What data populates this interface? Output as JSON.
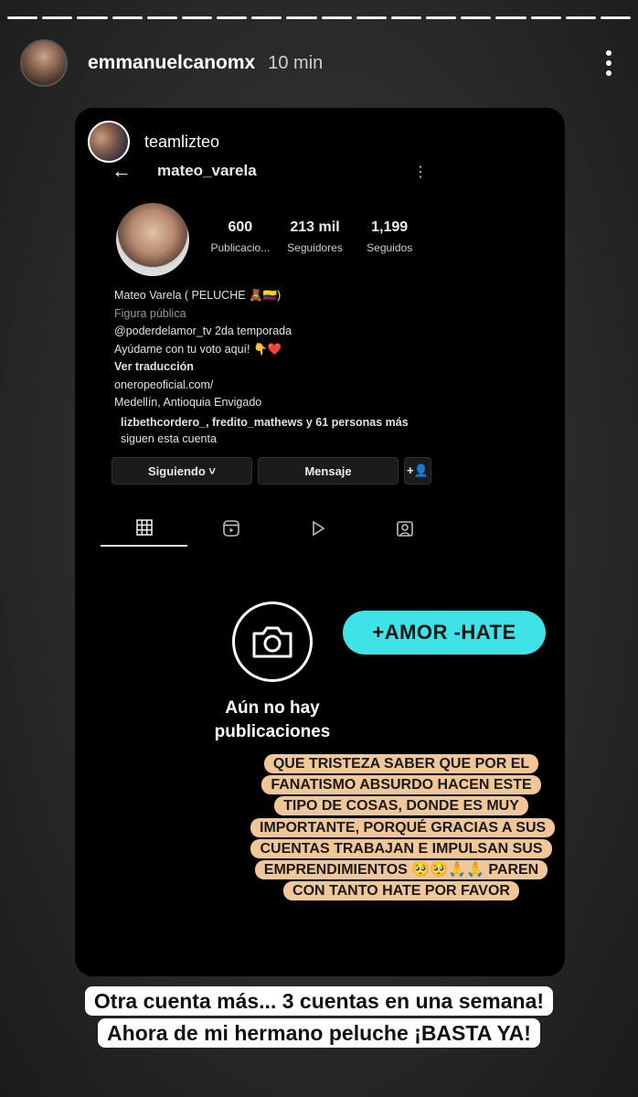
{
  "story": {
    "username": "emmanuelcanomx",
    "time": "10 min",
    "progress_segments": 18
  },
  "embedded": {
    "team_account": "teamlizteo",
    "profile": {
      "username": "mateo_varela",
      "stats": [
        {
          "value": "600",
          "label": "Publicacio..."
        },
        {
          "value": "213 mil",
          "label": "Seguidores"
        },
        {
          "value": "1,199",
          "label": "Seguidos"
        }
      ],
      "bio": {
        "name": "Mateo Varela ( PELUCHE 🧸🇨🇴)",
        "category": "Figura pública",
        "line1": "@poderdelamor_tv  2da temporada",
        "line2": "Ayúdame con tu voto aquí! 👇❤️",
        "translate": "Ver traducción",
        "link": "oneropeoficial.com/",
        "location": "Medellín, Antioquia Envigado"
      },
      "followed_by": {
        "line1": "lizbethcordero_, fredito_mathews y 61 personas más",
        "line2": "siguen esta cuenta"
      },
      "buttons": {
        "following": "Siguiendo ˅",
        "message": "Mensaje",
        "add_user": "+👤"
      },
      "empty_state": "Aún no hay publicaciones"
    }
  },
  "stickers": {
    "amor": "+AMOR -HATE",
    "note": "QUE TRISTEZA SABER QUE POR EL FANATISMO ABSURDO HACEN ESTE TIPO DE COSAS, DONDE ES MUY IMPORTANTE, PORQUÉ GRACIAS A SUS CUENTAS TRABAJAN E IMPULSAN SUS EMPRENDIMIENTOS 🥺🥺🙏🙏 PAREN CON TANTO HATE POR FAVOR"
  },
  "caption": {
    "line1": "Otra cuenta más... 3 cuentas en una semana!",
    "line2": "Ahora de mi hermano peluche ¡BASTA YA!"
  }
}
